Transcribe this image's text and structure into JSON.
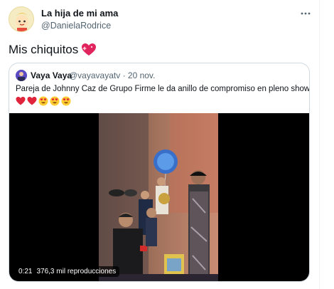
{
  "tweet": {
    "author_name": "La hija de mi ama",
    "author_handle": "@DanielaRodrice",
    "text": "Mis chiquitos",
    "text_emoji": "sparkling-heart"
  },
  "quote": {
    "author_name": "Vaya Vaya",
    "author_handle": "@vayavayatv",
    "separator": "·",
    "date": "20 nov.",
    "text": "Pareja de Johnny Caz de Grupo Firme le da anillo de compromiso en pleno show",
    "emojis": [
      "red-heart",
      "red-heart",
      "heart-eyes",
      "heart-eyes",
      "heart-eyes"
    ],
    "video": {
      "duration": "0:21",
      "views": "376,3 mil reproducciones"
    }
  },
  "colors": {
    "text_primary": "#0f1419",
    "text_secondary": "#536471",
    "border": "#cfd9de",
    "heart_pink": "#e0245e"
  }
}
